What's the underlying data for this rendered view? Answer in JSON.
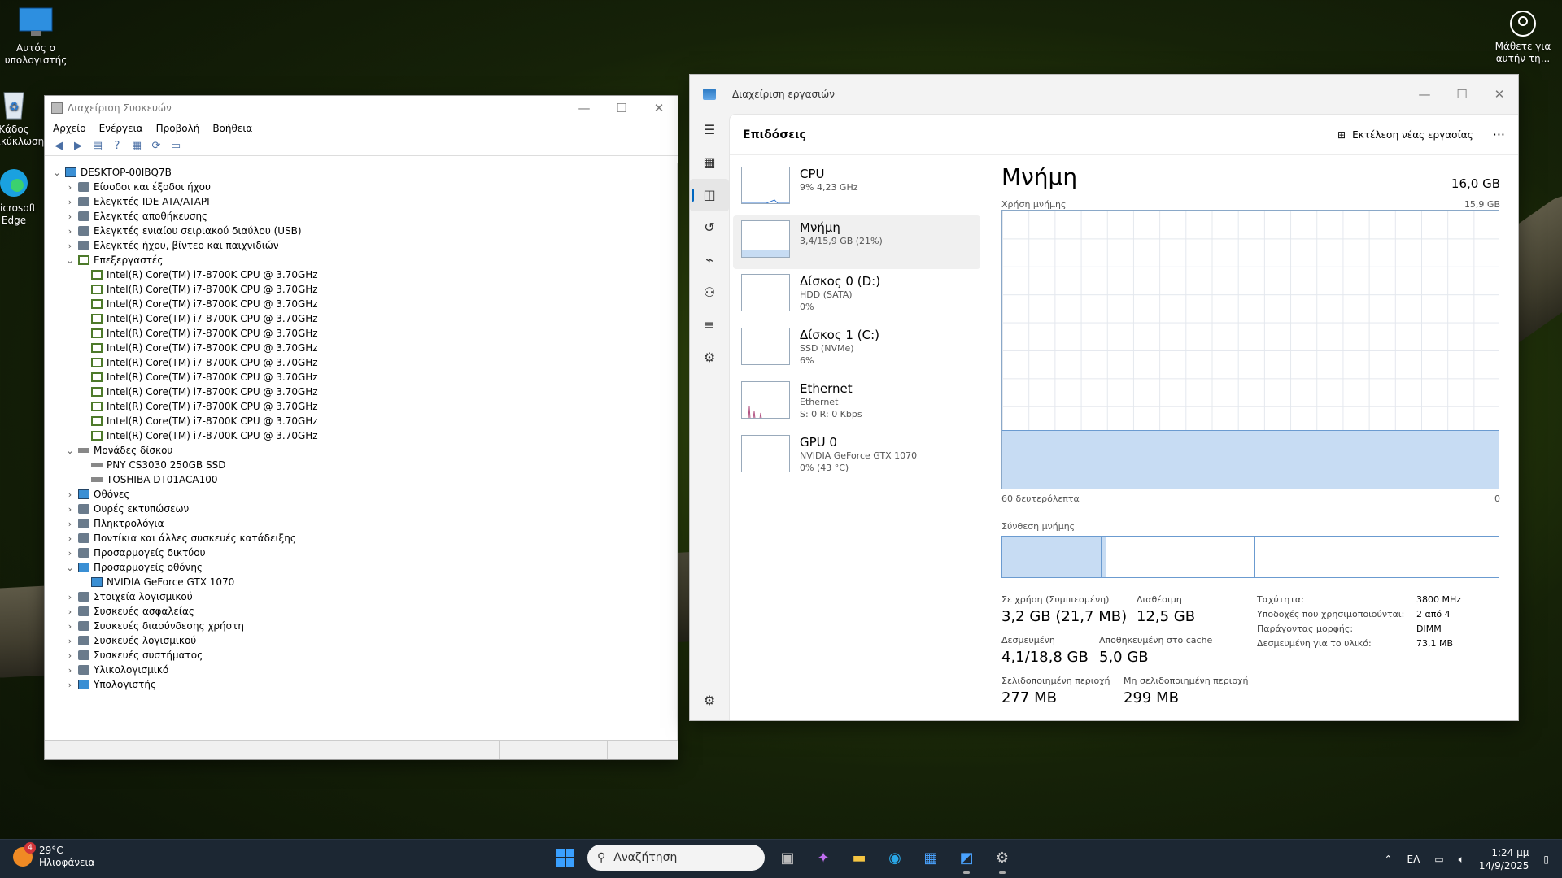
{
  "desktop": {
    "icons": [
      {
        "label": "Αυτός ο υπολογιστής",
        "icon": "monitor-icon"
      },
      {
        "label": "Κάδος Ανακύκλωσης",
        "icon": "recycle-bin-icon"
      },
      {
        "label": "Microsoft Edge",
        "icon": "edge-icon"
      }
    ],
    "learn": {
      "label": "Μάθετε για αυτήν τη...",
      "icon": "camera-icon"
    }
  },
  "device_manager": {
    "title": "Διαχείριση Συσκευών",
    "menu": [
      "Αρχείο",
      "Ενέργεια",
      "Προβολή",
      "Βοήθεια"
    ],
    "toolbar": [
      "back-icon",
      "forward-icon",
      "properties-icon",
      "help-icon",
      "view-icon",
      "scan-icon",
      "monitor-icon"
    ],
    "tree": [
      {
        "label": "DESKTOP-00IBQ7B",
        "level": 0,
        "expanded": true,
        "icon": "computer-icon"
      },
      {
        "label": "Είσοδοι και έξοδοι ήχου",
        "level": 1,
        "expanded": false,
        "icon": "speaker-icon"
      },
      {
        "label": "Ελεγκτές IDE ATA/ATAPI",
        "level": 1,
        "expanded": false,
        "icon": "ide-icon"
      },
      {
        "label": "Ελεγκτές αποθήκευσης",
        "level": 1,
        "expanded": false,
        "icon": "storage-icon"
      },
      {
        "label": "Ελεγκτές ενιαίου σειριακού διαύλου (USB)",
        "level": 1,
        "expanded": false,
        "icon": "usb-icon"
      },
      {
        "label": "Ελεγκτές ήχου, βίντεο και παιχνιδιών",
        "level": 1,
        "expanded": false,
        "icon": "sound-icon"
      },
      {
        "label": "Επεξεργαστές",
        "level": 1,
        "expanded": true,
        "icon": "cpu-icon"
      },
      {
        "label": "Intel(R) Core(TM) i7-8700K CPU @ 3.70GHz",
        "level": 2,
        "icon": "cpu-icon"
      },
      {
        "label": "Intel(R) Core(TM) i7-8700K CPU @ 3.70GHz",
        "level": 2,
        "icon": "cpu-icon"
      },
      {
        "label": "Intel(R) Core(TM) i7-8700K CPU @ 3.70GHz",
        "level": 2,
        "icon": "cpu-icon"
      },
      {
        "label": "Intel(R) Core(TM) i7-8700K CPU @ 3.70GHz",
        "level": 2,
        "icon": "cpu-icon"
      },
      {
        "label": "Intel(R) Core(TM) i7-8700K CPU @ 3.70GHz",
        "level": 2,
        "icon": "cpu-icon"
      },
      {
        "label": "Intel(R) Core(TM) i7-8700K CPU @ 3.70GHz",
        "level": 2,
        "icon": "cpu-icon"
      },
      {
        "label": "Intel(R) Core(TM) i7-8700K CPU @ 3.70GHz",
        "level": 2,
        "icon": "cpu-icon"
      },
      {
        "label": "Intel(R) Core(TM) i7-8700K CPU @ 3.70GHz",
        "level": 2,
        "icon": "cpu-icon"
      },
      {
        "label": "Intel(R) Core(TM) i7-8700K CPU @ 3.70GHz",
        "level": 2,
        "icon": "cpu-icon"
      },
      {
        "label": "Intel(R) Core(TM) i7-8700K CPU @ 3.70GHz",
        "level": 2,
        "icon": "cpu-icon"
      },
      {
        "label": "Intel(R) Core(TM) i7-8700K CPU @ 3.70GHz",
        "level": 2,
        "icon": "cpu-icon"
      },
      {
        "label": "Intel(R) Core(TM) i7-8700K CPU @ 3.70GHz",
        "level": 2,
        "icon": "cpu-icon"
      },
      {
        "label": "Μονάδες δίσκου",
        "level": 1,
        "expanded": true,
        "icon": "disk-icon"
      },
      {
        "label": "PNY CS3030 250GB SSD",
        "level": 2,
        "icon": "disk-icon"
      },
      {
        "label": "TOSHIBA DT01ACA100",
        "level": 2,
        "icon": "disk-icon"
      },
      {
        "label": "Οθόνες",
        "level": 1,
        "expanded": false,
        "icon": "monitor-icon"
      },
      {
        "label": "Ουρές εκτυπώσεων",
        "level": 1,
        "expanded": false,
        "icon": "printer-icon"
      },
      {
        "label": "Πληκτρολόγια",
        "level": 1,
        "expanded": false,
        "icon": "keyboard-icon"
      },
      {
        "label": "Ποντίκια και άλλες συσκευές κατάδειξης",
        "level": 1,
        "expanded": false,
        "icon": "mouse-icon"
      },
      {
        "label": "Προσαρμογείς δικτύου",
        "level": 1,
        "expanded": false,
        "icon": "network-icon"
      },
      {
        "label": "Προσαρμογείς οθόνης",
        "level": 1,
        "expanded": true,
        "icon": "display-adapter-icon"
      },
      {
        "label": "NVIDIA GeForce GTX 1070",
        "level": 2,
        "icon": "display-adapter-icon"
      },
      {
        "label": "Στοιχεία λογισμικού",
        "level": 1,
        "expanded": false,
        "icon": "software-component-icon"
      },
      {
        "label": "Συσκευές ασφαλείας",
        "level": 1,
        "expanded": false,
        "icon": "security-icon"
      },
      {
        "label": "Συσκευές διασύνδεσης χρήστη",
        "level": 1,
        "expanded": false,
        "icon": "hid-icon"
      },
      {
        "label": "Συσκευές λογισμικού",
        "level": 1,
        "expanded": false,
        "icon": "software-device-icon"
      },
      {
        "label": "Συσκευές συστήματος",
        "level": 1,
        "expanded": false,
        "icon": "system-icon"
      },
      {
        "label": "Υλικολογισμικό",
        "level": 1,
        "expanded": false,
        "icon": "firmware-icon"
      },
      {
        "label": "Υπολογιστής",
        "level": 1,
        "expanded": false,
        "icon": "computer-icon"
      }
    ]
  },
  "task_manager": {
    "title": "Διαχείριση εργασιών",
    "rail": [
      "menu-icon",
      "processes-icon",
      "performance-icon",
      "history-icon",
      "startup-icon",
      "users-icon",
      "details-icon",
      "services-icon",
      "settings-icon"
    ],
    "page_title": "Επιδόσεις",
    "run_task": "Εκτέλεση νέας εργασίας",
    "more": "···",
    "perf_items": [
      {
        "name": "CPU",
        "sub1": "9% 4,23 GHz",
        "sub2": ""
      },
      {
        "name": "Μνήμη",
        "sub1": "3,4/15,9 GB (21%)",
        "sub2": ""
      },
      {
        "name": "Δίσκος 0 (D:)",
        "sub1": "HDD (SATA)",
        "sub2": "0%"
      },
      {
        "name": "Δίσκος 1 (C:)",
        "sub1": "SSD (NVMe)",
        "sub2": "6%"
      },
      {
        "name": "Ethernet",
        "sub1": "Ethernet",
        "sub2": "S: 0 R: 0 Kbps"
      },
      {
        "name": "GPU 0",
        "sub1": "NVIDIA GeForce GTX 1070",
        "sub2": "0% (43 °C)"
      }
    ],
    "memory": {
      "title": "Μνήμη",
      "capacity": "16,0 GB",
      "usage_label": "Χρήση μνήμης",
      "max_label": "15,9 GB",
      "x_left": "60 δευτερόλεπτα",
      "x_right": "0",
      "usage_fraction": 0.21,
      "composition_label": "Σύνθεση μνήμης",
      "composition": [
        0.2,
        0.01,
        0.3,
        0.49
      ],
      "stats": [
        {
          "label": "Σε χρήση (Συμπιεσμένη)",
          "value": "3,2 GB (21,7 MB)"
        },
        {
          "label": "Διαθέσιμη",
          "value": "12,5 GB"
        },
        {
          "label": "Δεσμευμένη",
          "value": "4,1/18,8 GB"
        },
        {
          "label": "Αποθηκευμένη στο cache",
          "value": "5,0 GB"
        },
        {
          "label": "Σελιδοποιημένη περιοχή",
          "value": "277 MB"
        },
        {
          "label": "Μη σελιδοποιημένη περιοχή",
          "value": "299 MB"
        }
      ],
      "kv": [
        {
          "k": "Ταχύτητα:",
          "v": "3800 MHz"
        },
        {
          "k": "Υποδοχές που χρησιμοποιούνται:",
          "v": "2 από 4"
        },
        {
          "k": "Παράγοντας μορφής:",
          "v": "DIMM"
        },
        {
          "k": "Δεσμευμένη για το υλικό:",
          "v": "73,1 MB"
        }
      ]
    }
  },
  "taskbar": {
    "weather_temp": "29°C",
    "weather_desc": "Ηλιοφάνεια",
    "weather_badge": "4",
    "search_placeholder": "Αναζήτηση",
    "apps": [
      "task-view-icon",
      "copilot-icon",
      "file-explorer-icon",
      "edge-icon",
      "store-icon",
      "task-manager-icon",
      "device-manager-icon"
    ],
    "lang": "ΕΛ",
    "time": "1:24 μμ",
    "date": "14/9/2025"
  }
}
